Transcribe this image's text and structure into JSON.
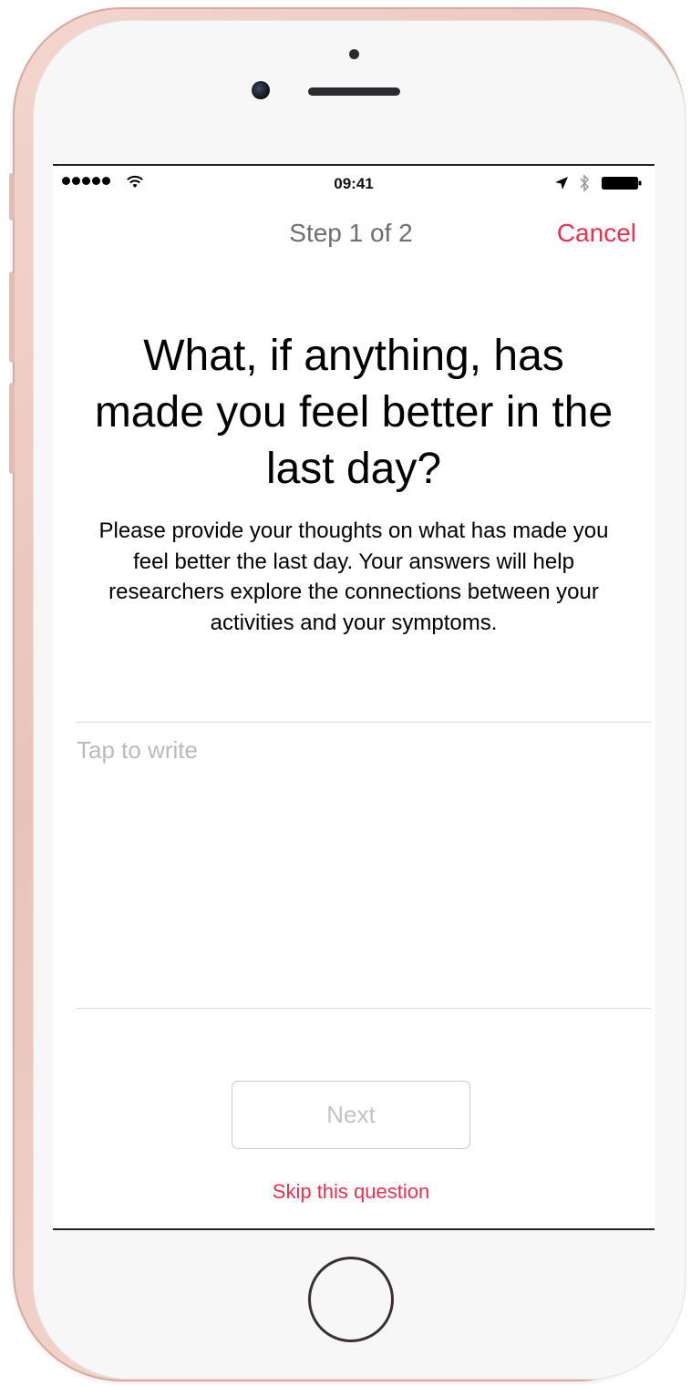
{
  "status_bar": {
    "time": "09:41",
    "signal_icon": "signal-dots-icon",
    "wifi_icon": "wifi-icon",
    "location_icon": "location-arrow-icon",
    "bluetooth_icon": "bluetooth-icon",
    "battery_icon": "battery-icon"
  },
  "nav": {
    "title": "Step 1 of 2",
    "cancel_label": "Cancel"
  },
  "question": {
    "title": "What, if anything, has made you feel better in the last day?",
    "description": "Please provide your thoughts on what has made you feel better the last day.  Your answers will help researchers explore the connections between your activities and your symptoms."
  },
  "answer": {
    "placeholder": "Tap to write",
    "value": ""
  },
  "actions": {
    "next_label": "Next",
    "skip_label": "Skip this question"
  },
  "colors": {
    "accent": "#e8304f",
    "nav_title": "#6e6e73",
    "disabled_button_text": "#c3c3c8",
    "placeholder": "#b9b9be",
    "phone_frame": "#e9c3b9"
  }
}
